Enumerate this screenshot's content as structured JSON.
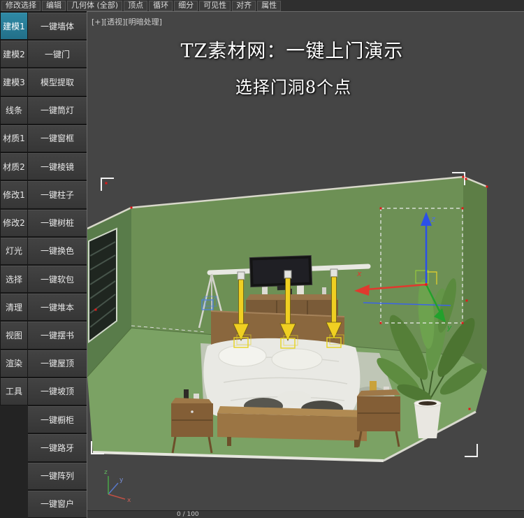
{
  "menu_bar": {
    "items": [
      "修改选择",
      "编辑",
      "几何体 (全部)",
      "顶点",
      "循环",
      "细分",
      "可见性",
      "对齐",
      "属性"
    ]
  },
  "sidebar": {
    "active_category": "建模1",
    "categories": [
      "建模1",
      "建模2",
      "建模3",
      "线条",
      "材质1",
      "材质2",
      "修改1",
      "修改2",
      "灯光",
      "选择",
      "清理",
      "视图",
      "渲染",
      "工具"
    ],
    "actions": [
      "一键墙体",
      "一键门",
      "模型提取",
      "一键筒灯",
      "一键窗框",
      "一键棱镜",
      "一键柱子",
      "一键树桩",
      "一键换色",
      "一键软包",
      "一键堆本",
      "一键摆书",
      "一键屋顶",
      "一键坡顶",
      "一键橱柜",
      "一键路牙",
      "一键阵列",
      "一键窗户"
    ]
  },
  "viewport": {
    "label": "[+][透视][明暗处理]",
    "overlay_title": "TZ素材网：一键上门演示",
    "overlay_subtitle": "选择门洞8个点",
    "timeline": "0 / 100",
    "gizmo": {
      "x": "x",
      "y": "y",
      "z": "z"
    },
    "axis": {
      "x": "x",
      "y": "y",
      "z": "z"
    }
  },
  "colors": {
    "active_tab": "#2a7d9b",
    "wall_green": "#6d9055",
    "floor_green": "#7ba264",
    "gizmo_x": "#e0392e",
    "gizmo_y": "#22a12c",
    "gizmo_z": "#2b50e8",
    "helper_yellow": "#f0cf22"
  }
}
